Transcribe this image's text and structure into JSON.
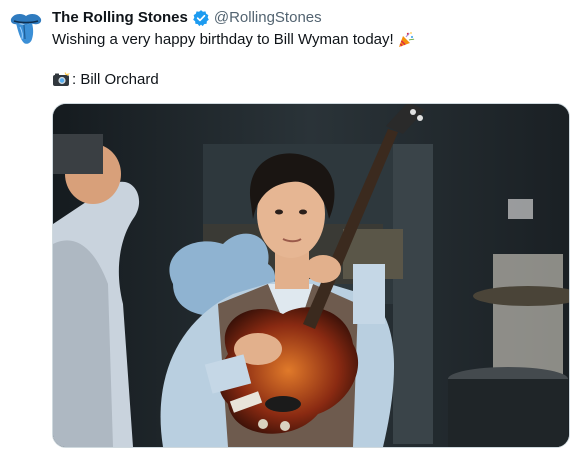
{
  "tweet": {
    "author_name": "The Rolling Stones",
    "author_handle": "@RollingStones",
    "text_line1": "Wishing a very happy birthday to Bill Wyman today!",
    "text_line2": ": Bill Orchard",
    "avatar_icon": "rolling-stones-tongue-logo",
    "verified_icon": "verified-badge-icon",
    "party_emoji": "party-popper-icon",
    "camera_emoji": "camera-flash-icon",
    "verified_color": "#1d9bf0",
    "avatar_color": "#2f7bbf"
  },
  "media": {
    "type": "photo",
    "description_icon": "photo-bassist"
  }
}
